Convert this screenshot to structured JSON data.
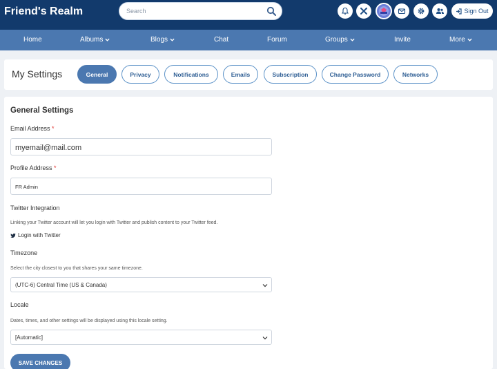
{
  "header": {
    "logo": "Friend's Realm",
    "search_placeholder": "Search",
    "icons": [
      "bell-icon",
      "tools-icon",
      "avatar-badge-icon",
      "envelope-icon",
      "gear-icon",
      "users-icon"
    ],
    "signout_label": "Sign Out"
  },
  "nav": {
    "items": [
      {
        "label": "Home",
        "dropdown": false
      },
      {
        "label": "Albums",
        "dropdown": true
      },
      {
        "label": "Blogs",
        "dropdown": true
      },
      {
        "label": "Chat",
        "dropdown": false
      },
      {
        "label": "Forum",
        "dropdown": false
      },
      {
        "label": "Groups",
        "dropdown": true
      },
      {
        "label": "Invite",
        "dropdown": false
      },
      {
        "label": "More",
        "dropdown": true
      }
    ]
  },
  "settings": {
    "title": "My Settings",
    "tabs": [
      {
        "label": "General",
        "active": true
      },
      {
        "label": "Privacy",
        "active": false
      },
      {
        "label": "Notifications",
        "active": false
      },
      {
        "label": "Emails",
        "active": false
      },
      {
        "label": "Subscription",
        "active": false
      },
      {
        "label": "Change Password",
        "active": false
      },
      {
        "label": "Networks",
        "active": false
      }
    ]
  },
  "form": {
    "section_title": "General Settings",
    "email": {
      "label": "Email Address",
      "required_mark": "*",
      "value": "myemail@mail.com"
    },
    "profile": {
      "label": "Profile Address",
      "required_mark": "*",
      "value": "FR Admin"
    },
    "twitter": {
      "label": "Twitter Integration",
      "hint": "Linking your Twitter account will let you login with Twitter and publish content to your Twitter feed.",
      "link": "Login with Twitter"
    },
    "timezone": {
      "label": "Timezone",
      "hint": "Select the city closest to you that shares your same timezone.",
      "value": "(UTC-6) Central Time (US & Canada)"
    },
    "locale": {
      "label": "Locale",
      "hint": "Dates, times, and other settings will be displayed using this locale setting.",
      "value": "[Automatic]"
    },
    "save_label": "SAVE CHANGES"
  }
}
